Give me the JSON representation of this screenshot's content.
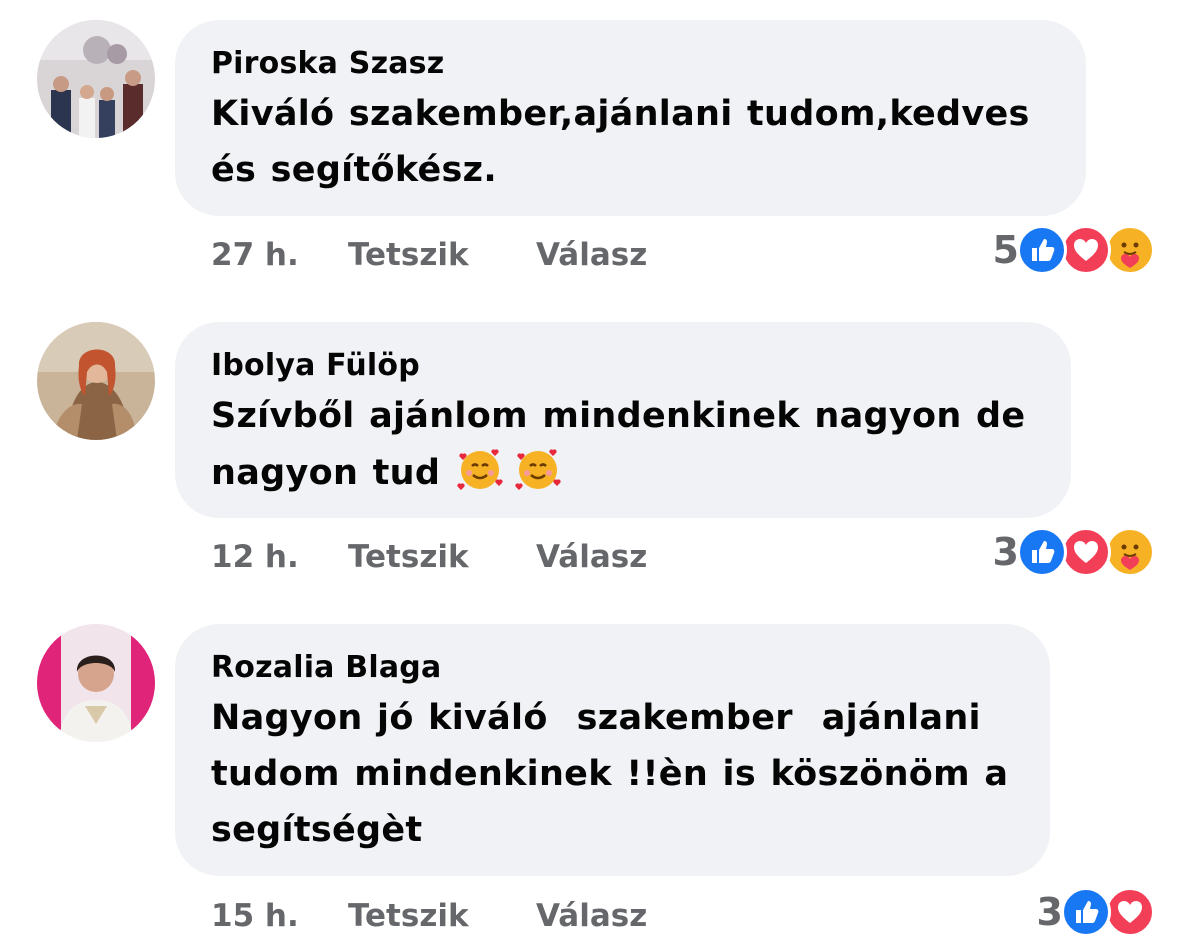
{
  "comments": [
    {
      "author": "Piroska Szasz",
      "text": "Kiváló szakember,ajánlani tudom,kedves\nés segítőkész.",
      "time": "27 h.",
      "like_label": "Tetszik",
      "reply_label": "Válasz",
      "reaction_count": "5",
      "reactions": [
        "like-icon",
        "love-icon",
        "care-icon"
      ]
    },
    {
      "author": "Ibolya Fülöp",
      "text": "Szívből ajánlom mindenkinek nagyon de\nnagyon tud ",
      "emoji": [
        "smiling-face-with-hearts-emoji",
        "smiling-face-with-hearts-emoji"
      ],
      "time": "12 h.",
      "like_label": "Tetszik",
      "reply_label": "Válasz",
      "reaction_count": "3",
      "reactions": [
        "like-icon",
        "love-icon",
        "care-icon"
      ]
    },
    {
      "author": "Rozalia Blaga",
      "text": "Nagyon jó kiváló  szakember  ajánlani\ntudom mindenkinek !!èn is köszönöm a\nsegítségèt",
      "time": "15 h.",
      "like_label": "Tetszik",
      "reply_label": "Válasz",
      "reaction_count": "3",
      "reactions": [
        "like-icon",
        "love-icon"
      ]
    }
  ],
  "colors": {
    "bubble": "#f0f2f5",
    "meta_text": "#65676b",
    "like": "#1877f2",
    "love": "#f33e58",
    "care": "#f7b125"
  }
}
